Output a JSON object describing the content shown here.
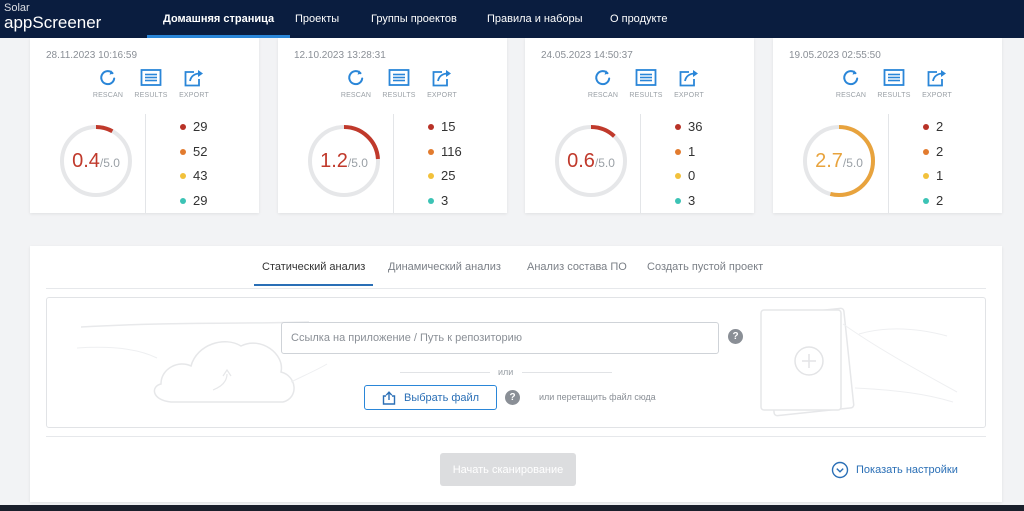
{
  "brand": {
    "line1": "Solar",
    "line2": "appScreener"
  },
  "nav": [
    {
      "label": "Домашняя страница",
      "active": true
    },
    {
      "label": "Проекты",
      "active": false
    },
    {
      "label": "Группы проектов",
      "active": false
    },
    {
      "label": "Правила и наборы",
      "active": false
    },
    {
      "label": "О продукте",
      "active": false
    }
  ],
  "actions": {
    "rescan": "RESCAN",
    "results": "RESULTS",
    "export": "EXPORT"
  },
  "colors": {
    "accent": "#2a86d8",
    "critical": "#b83227",
    "high": "#e27b2e",
    "medium": "#f2c13b",
    "low": "#3cc3b5",
    "score_red": "#c0392b",
    "score_orange": "#e8a33d",
    "ring_track": "#e6e7e9"
  },
  "scans": [
    {
      "date": "28.11.2023 10:16:59",
      "score": "0.4",
      "score_max": "/5.0",
      "level": "red",
      "counts": [
        "29",
        "52",
        "43",
        "29"
      ]
    },
    {
      "date": "12.10.2023 13:28:31",
      "score": "1.2",
      "score_max": "/5.0",
      "level": "red",
      "counts": [
        "15",
        "116",
        "25",
        "3"
      ]
    },
    {
      "date": "24.05.2023 14:50:37",
      "score": "0.6",
      "score_max": "/5.0",
      "level": "red",
      "counts": [
        "36",
        "1",
        "0",
        "3"
      ]
    },
    {
      "date": "19.05.2023 02:55:50",
      "score": "2.7",
      "score_max": "/5.0",
      "level": "orange",
      "counts": [
        "2",
        "2",
        "1",
        "2"
      ]
    }
  ],
  "tabs": [
    {
      "label": "Статический анализ",
      "active": true
    },
    {
      "label": "Динамический анализ",
      "active": false
    },
    {
      "label": "Анализ состава ПО",
      "active": false
    },
    {
      "label": "Создать пустой проект",
      "active": false
    }
  ],
  "upload": {
    "url_placeholder": "Ссылка на приложение / Путь к репозиторию",
    "help": "?",
    "or_label": "или",
    "choose_file": "Выбрать файл",
    "drop_hint": "или перетащить файл сюда"
  },
  "footer": {
    "start_scan": "Начать сканирование",
    "show_settings": "Показать настройки"
  }
}
